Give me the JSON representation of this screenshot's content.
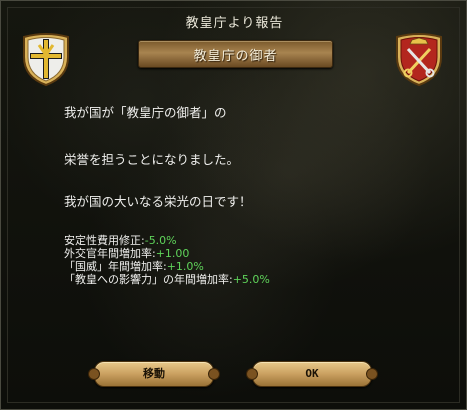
{
  "dialog": {
    "title": "教皇庁より報告",
    "subtitle": "教皇庁の御者",
    "message_lines": [
      "我が国が「教皇庁の御者」の",
      "栄誉を担うことになりました。",
      "我が国の大いなる栄光の日です！"
    ],
    "stats": [
      {
        "label": "安定性費用修正:",
        "value": "-5.0%"
      },
      {
        "label": "外交官年間増加率:",
        "value": "+1.00"
      },
      {
        "label": "「国威」年間増加率:",
        "value": "+1.0%"
      },
      {
        "label": "「教皇への影響力」の年間増加率:",
        "value": "+5.0%"
      }
    ],
    "buttons": {
      "move": "移動",
      "ok": "OK"
    },
    "icons": {
      "left_shield": "papal-cross-shield-icon",
      "right_shield": "papal-keys-shield-icon"
    },
    "colors": {
      "positive_value": "#5fd35a",
      "text": "#f0f0ee",
      "gold": "#caa060",
      "shield_red": "#b3261e"
    }
  }
}
